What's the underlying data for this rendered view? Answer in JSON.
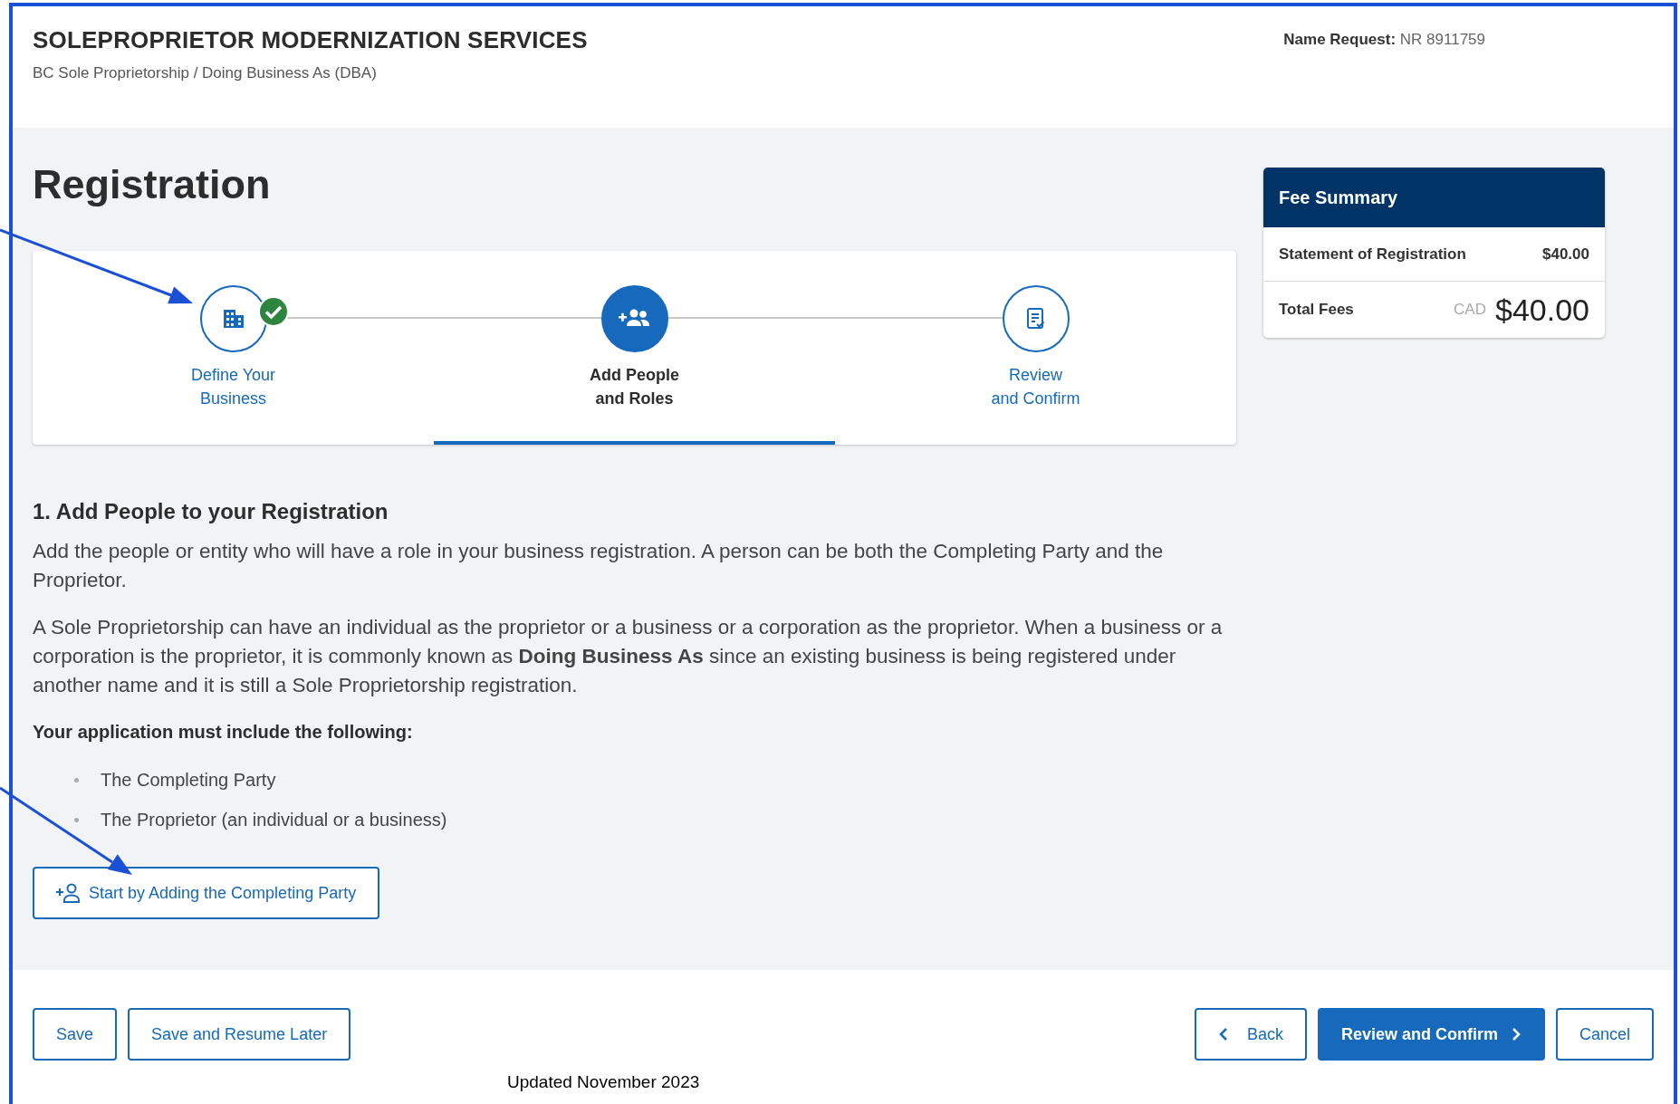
{
  "header": {
    "title": "SOLEPROPRIETOR MODERNIZATION SERVICES",
    "subtitle": "BC Sole Proprietorship / Doing Business As (DBA)",
    "name_request_label": "Name Request:",
    "name_request_value": "NR 8911759"
  },
  "page_title": "Registration",
  "steps": [
    {
      "label": [
        "Define Your",
        "Business"
      ],
      "completed": true,
      "selected": false
    },
    {
      "label": [
        "Add People",
        "and Roles"
      ],
      "completed": false,
      "selected": true
    },
    {
      "label": [
        "Review",
        "and Confirm"
      ],
      "completed": false,
      "selected": false
    }
  ],
  "fee_summary": {
    "title": "Fee Summary",
    "items": [
      {
        "label": "Statement of Registration",
        "amount": "$40.00"
      }
    ],
    "total_label": "Total Fees",
    "currency": "CAD",
    "total": "$40.00"
  },
  "section": {
    "heading": "1. Add People to your Registration",
    "paragraphs": [
      "Add the people or entity who will have a role in your business registration. A person can be both the Completing Party and the Proprietor.",
      "A Sole Proprietorship can have an individual as the proprietor or a business or a corporation as the proprietor. When a business or a corporation is the proprietor, it is commonly known as **Doing Business As** since an existing business is being registered under another name and it is still a Sole Proprietorship registration."
    ],
    "requirements_heading": "Your application must include the following:",
    "requirements": [
      "The Completing Party",
      "The Proprietor (an individual or a business)"
    ],
    "add_button": "Start by Adding the Completing Party"
  },
  "footer": {
    "left_buttons": [
      "Save",
      "Save and Resume Later"
    ],
    "back": "Back",
    "primary": "Review and Confirm",
    "cancel": "Cancel",
    "note": "Updated November 2023"
  }
}
